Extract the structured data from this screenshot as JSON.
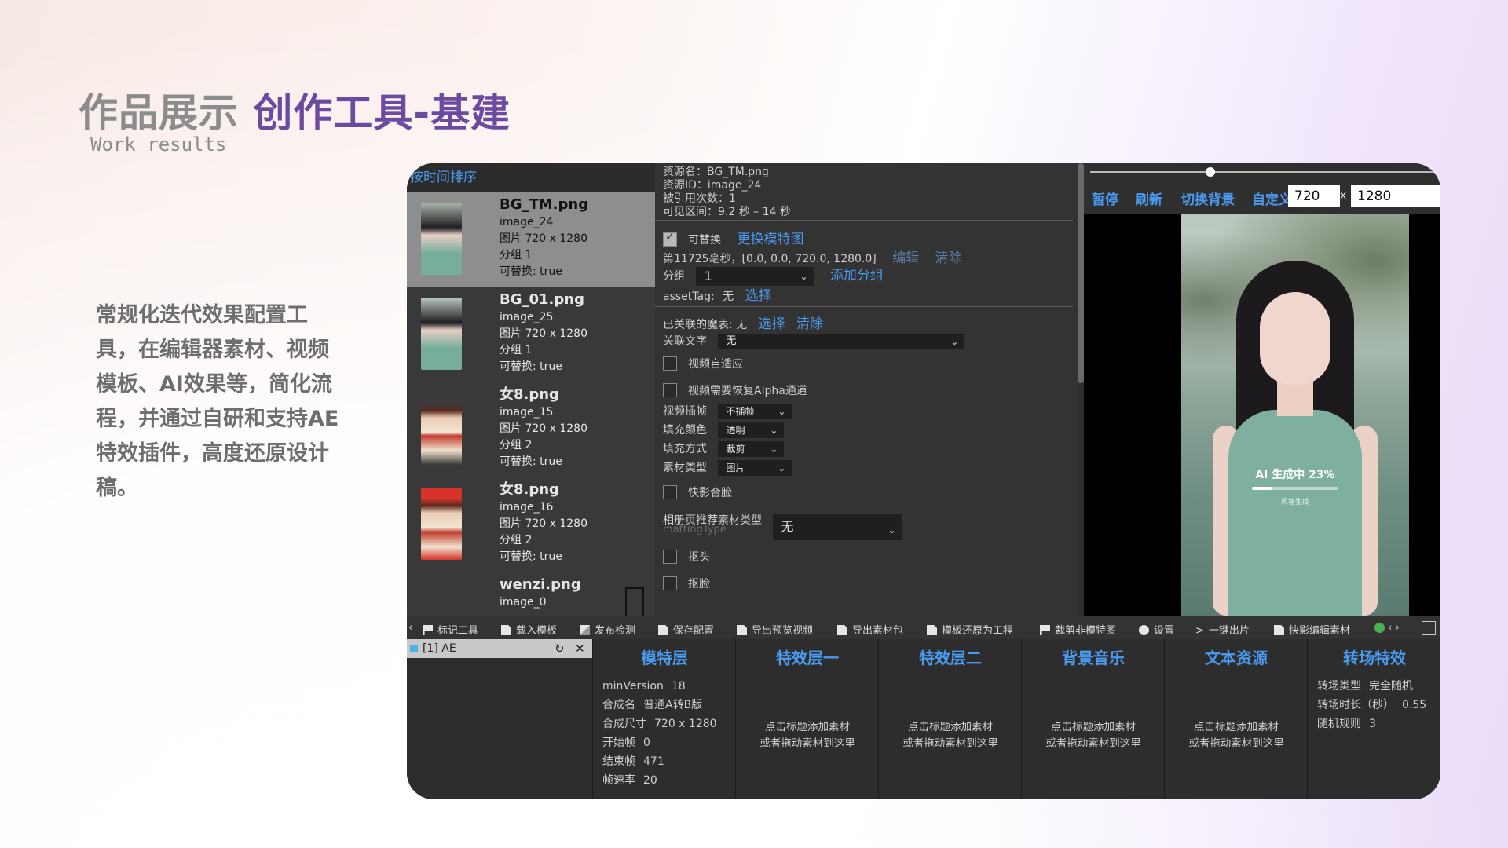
{
  "slide": {
    "title_gray": "作品展示",
    "title_purple": "创作工具-基建",
    "subtitle": "Work results",
    "description": "常规化迭代效果配置工具，在编辑器素材、视频模板、AI效果等，简化流程，并通过自研和支持AE特效插件，高度还原设计稿。"
  },
  "asset_list": {
    "header": "按时间排序",
    "items": [
      {
        "name": "BG_TM.png",
        "id": "image_24",
        "size": "图片 720 x 1280",
        "group": "分组 1",
        "replaceable": "可替换: true"
      },
      {
        "name": "BG_01.png",
        "id": "image_25",
        "size": "图片 720 x 1280",
        "group": "分组 1",
        "replaceable": "可替换: true"
      },
      {
        "name": "女8.png",
        "id": "image_15",
        "size": "图片 720 x 1280",
        "group": "分组 2",
        "replaceable": "可替换: true"
      },
      {
        "name": "女8.png",
        "id": "image_16",
        "size": "图片 720 x 1280",
        "group": "分组 2",
        "replaceable": "可替换: true"
      },
      {
        "name": "wenzi.png",
        "id": "image_0"
      }
    ]
  },
  "props": {
    "res_name": "资源名：BG_TM.png",
    "res_id": "资源ID：image_24",
    "ref_count": "被引用次数：1",
    "visible_range": "可见区间：9.2 秒 – 14 秒",
    "replaceable_label": "可替换",
    "replace_model_link": "更换模特图",
    "frame_info": "第11725毫秒，[0.0, 0.0, 720.0, 1280.0]",
    "edit_link": "编辑",
    "clear_link": "清除",
    "group_label": "分组",
    "group_value": "1",
    "add_group_link": "添加分组",
    "asset_tag_label": "assetTag:",
    "asset_tag_value": "无",
    "select_link": "选择",
    "linked_table": "已关联的魔表: 无",
    "linked_select": "选择",
    "linked_clear": "清除",
    "linked_text_label": "关联文字",
    "linked_text_value": "无",
    "video_adapt": "视频自适应",
    "video_alpha": "视频需要恢复Alpha通道",
    "video_interp_label": "视频插帧",
    "video_interp_value": "不插帧",
    "fill_color_label": "填充颜色",
    "fill_color_value": "透明",
    "fill_mode_label": "填充方式",
    "fill_mode_value": "裁剪",
    "material_type_label": "素材类型",
    "material_type_value": "图片",
    "face_merge": "快影合脸",
    "album_rec_label": "相册页推荐素材类型",
    "album_rec_value": "无",
    "matting_type": "mattingType",
    "cutout_head": "抠头",
    "cutout_face": "抠脸"
  },
  "preview": {
    "pause": "暂停",
    "refresh": "刷新",
    "switch_bg": "切换背景",
    "custom_bg": "自定义背景",
    "width": "720",
    "times": "x",
    "height": "1280",
    "ai_status": "AI 生成中 23%",
    "ai_progress": 0.23,
    "ai_sub": "风格生成"
  },
  "toolbar": {
    "left_arrow": "‹",
    "items": [
      "标记工具",
      "载入模板",
      "发布检测",
      "保存配置",
      "导出预览视频",
      "导出素材包",
      "模板还原为工程",
      "裁剪非模特图",
      "设置",
      "一键出片",
      "快影编辑素材"
    ],
    "overflow": "‹ ›"
  },
  "bottom": {
    "ae_tab": "[1] AE",
    "refresh_icon": "↻",
    "close_icon": "✕",
    "columns": [
      {
        "title": "模特层",
        "rows": [
          [
            "minVersion",
            "18"
          ],
          [
            "合成名",
            "普通A转B版"
          ],
          [
            "合成尺寸",
            "720 x 1280"
          ],
          [
            "开始帧",
            "0"
          ],
          [
            "结束帧",
            "471"
          ],
          [
            "帧速率",
            "20"
          ]
        ]
      },
      {
        "title": "特效层一",
        "hint1": "点击标题添加素材",
        "hint2": "或者拖动素材到这里"
      },
      {
        "title": "特效层二",
        "hint1": "点击标题添加素材",
        "hint2": "或者拖动素材到这里"
      },
      {
        "title": "背景音乐",
        "hint1": "点击标题添加素材",
        "hint2": "或者拖动素材到这里"
      },
      {
        "title": "文本资源",
        "hint1": "点击标题添加素材",
        "hint2": "或者拖动素材到这里"
      },
      {
        "title": "转场特效",
        "rows": [
          [
            "转场类型",
            "完全随机"
          ],
          [
            "转场时长（秒）",
            "0.55"
          ],
          [
            "随机规则",
            "3"
          ]
        ]
      }
    ]
  },
  "colors": {
    "accent_blue": "#4a9af0",
    "title_purple": "#6a4ba0"
  }
}
